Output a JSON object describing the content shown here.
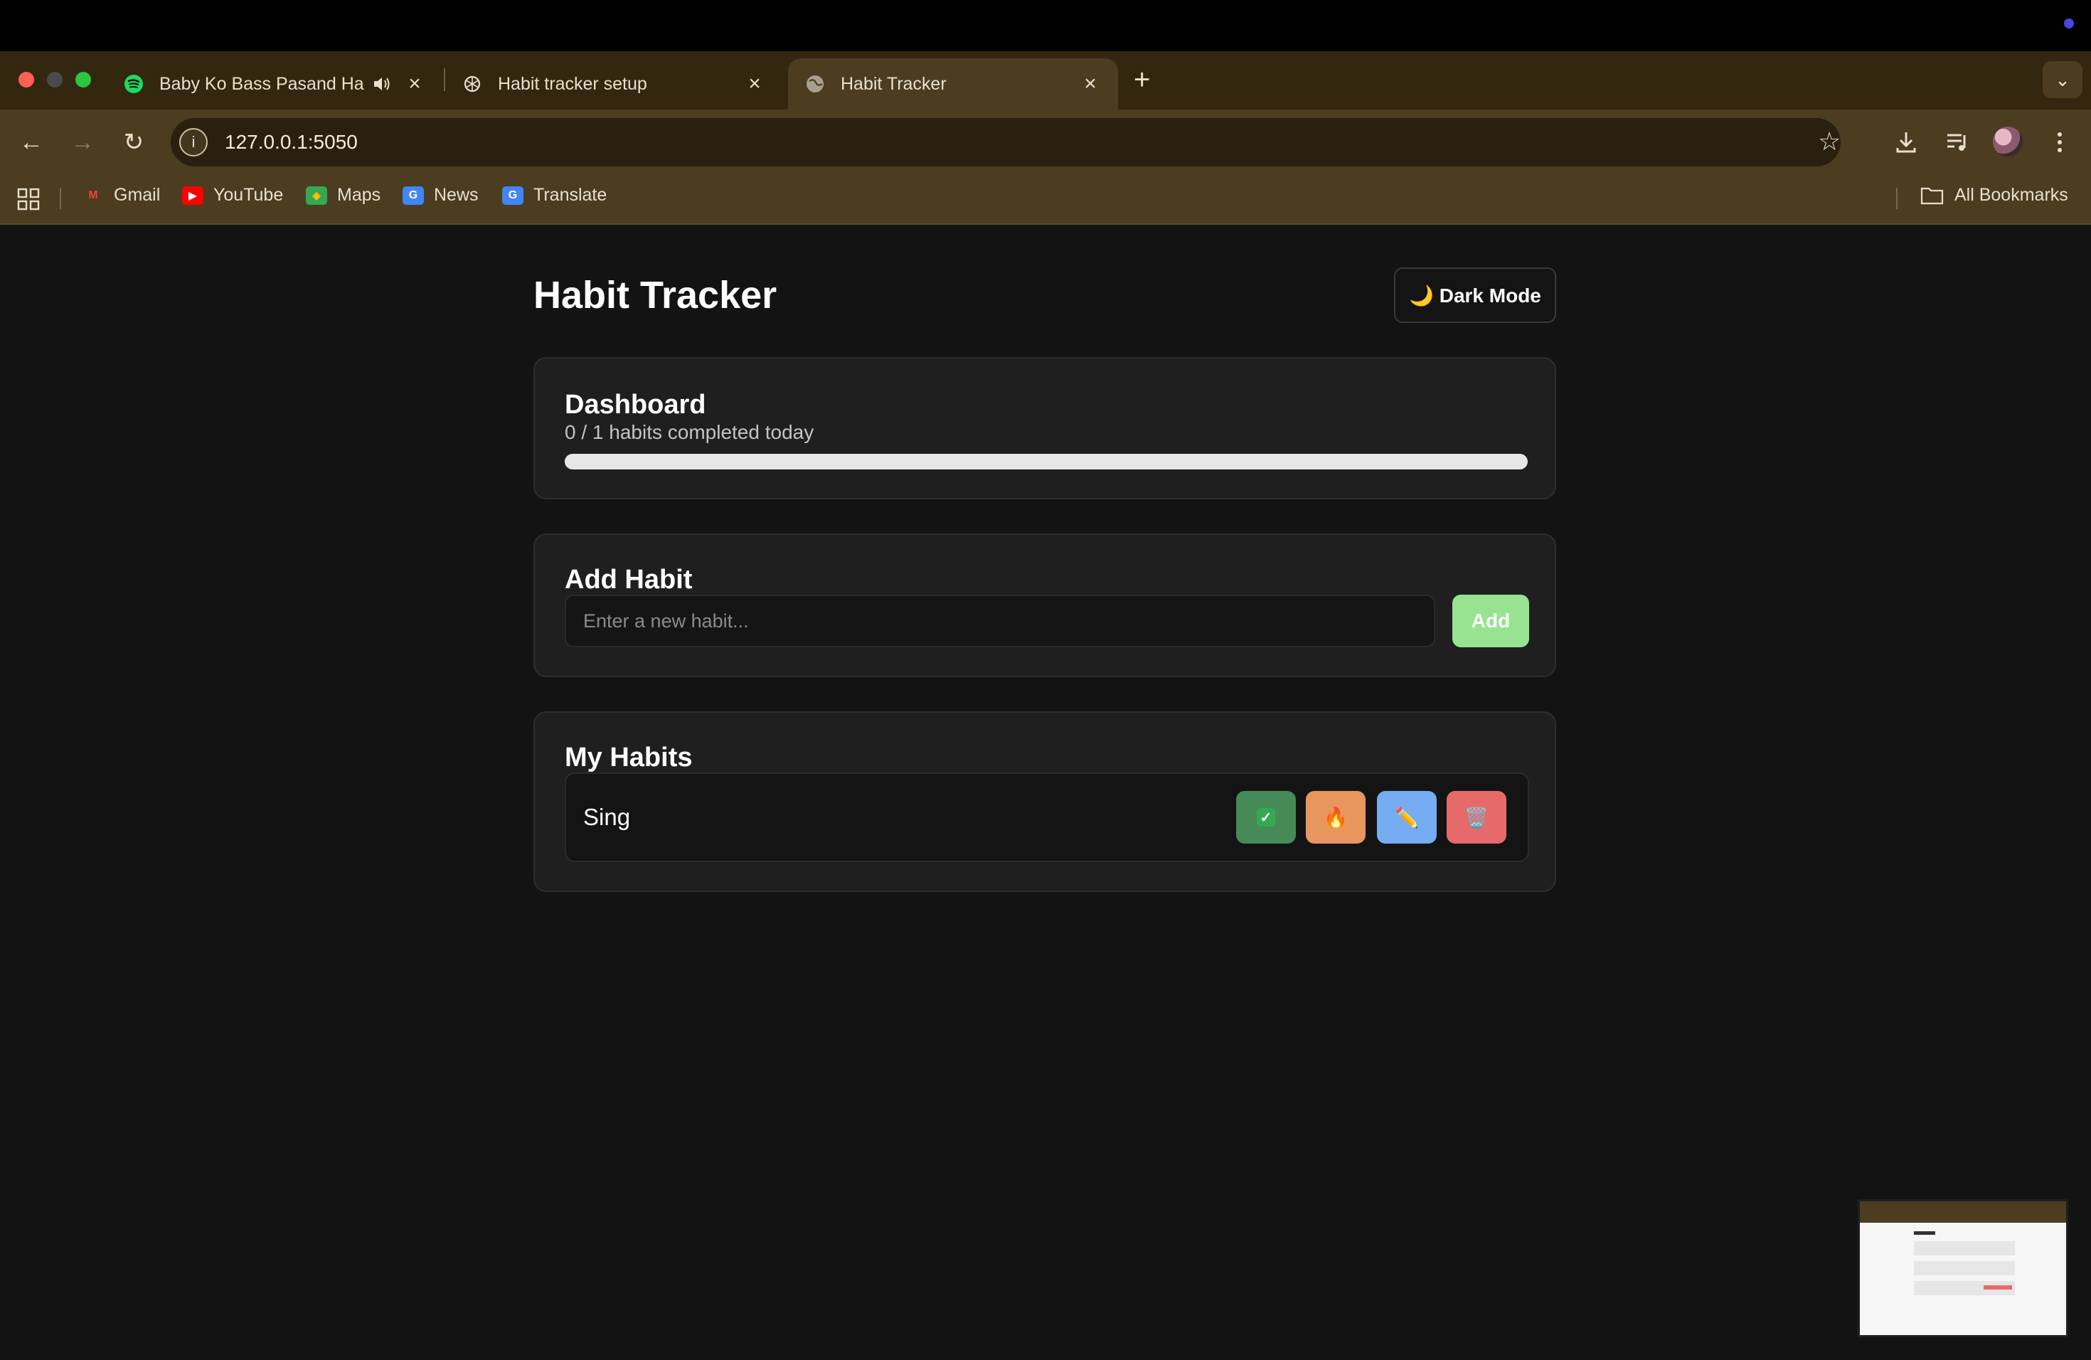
{
  "browser": {
    "tabs": [
      {
        "title": "Baby Ko Bass Pasand Hai",
        "favicon": "spotify-icon",
        "audio": true,
        "active": false
      },
      {
        "title": "Habit tracker setup",
        "favicon": "openai-icon",
        "active": false
      },
      {
        "title": "Habit Tracker",
        "favicon": "globe-icon",
        "active": true
      }
    ],
    "new_tab": "+",
    "url": "127.0.0.1:5050",
    "bookmarks": [
      {
        "label": "Gmail",
        "icon": "gmail-icon",
        "color": "#ea4335"
      },
      {
        "label": "YouTube",
        "icon": "youtube-icon",
        "color": "#ff0000"
      },
      {
        "label": "Maps",
        "icon": "maps-icon",
        "color": "#34a853"
      },
      {
        "label": "News",
        "icon": "news-icon",
        "color": "#4285f4"
      },
      {
        "label": "Translate",
        "icon": "translate-icon",
        "color": "#4285f4"
      }
    ],
    "all_bookmarks": "All Bookmarks",
    "colors": {
      "frame": "#33280f",
      "toolbar": "#4c3c20"
    }
  },
  "app": {
    "title": "Habit Tracker",
    "dark_mode_label": "🌙 Dark Mode",
    "dashboard": {
      "title": "Dashboard",
      "completed": 0,
      "total": 1,
      "summary": "0 / 1 habits completed today",
      "progress_percent": 0
    },
    "add_habit": {
      "title": "Add Habit",
      "placeholder": "Enter a new habit...",
      "value": "",
      "button_label": "Add"
    },
    "my_habits": {
      "title": "My Habits",
      "items": [
        {
          "name": "Sing",
          "actions": [
            {
              "name": "complete",
              "icon": "check-mark-icon",
              "glyph": "✓",
              "color": "#468a57"
            },
            {
              "name": "streak",
              "icon": "fire-icon",
              "glyph": "🔥",
              "color": "#e8965d"
            },
            {
              "name": "edit",
              "icon": "pencil-icon",
              "glyph": "✏️",
              "color": "#76adf2"
            },
            {
              "name": "delete",
              "icon": "trash-icon",
              "glyph": "🗑️",
              "color": "#e66a6a"
            }
          ]
        }
      ]
    }
  }
}
